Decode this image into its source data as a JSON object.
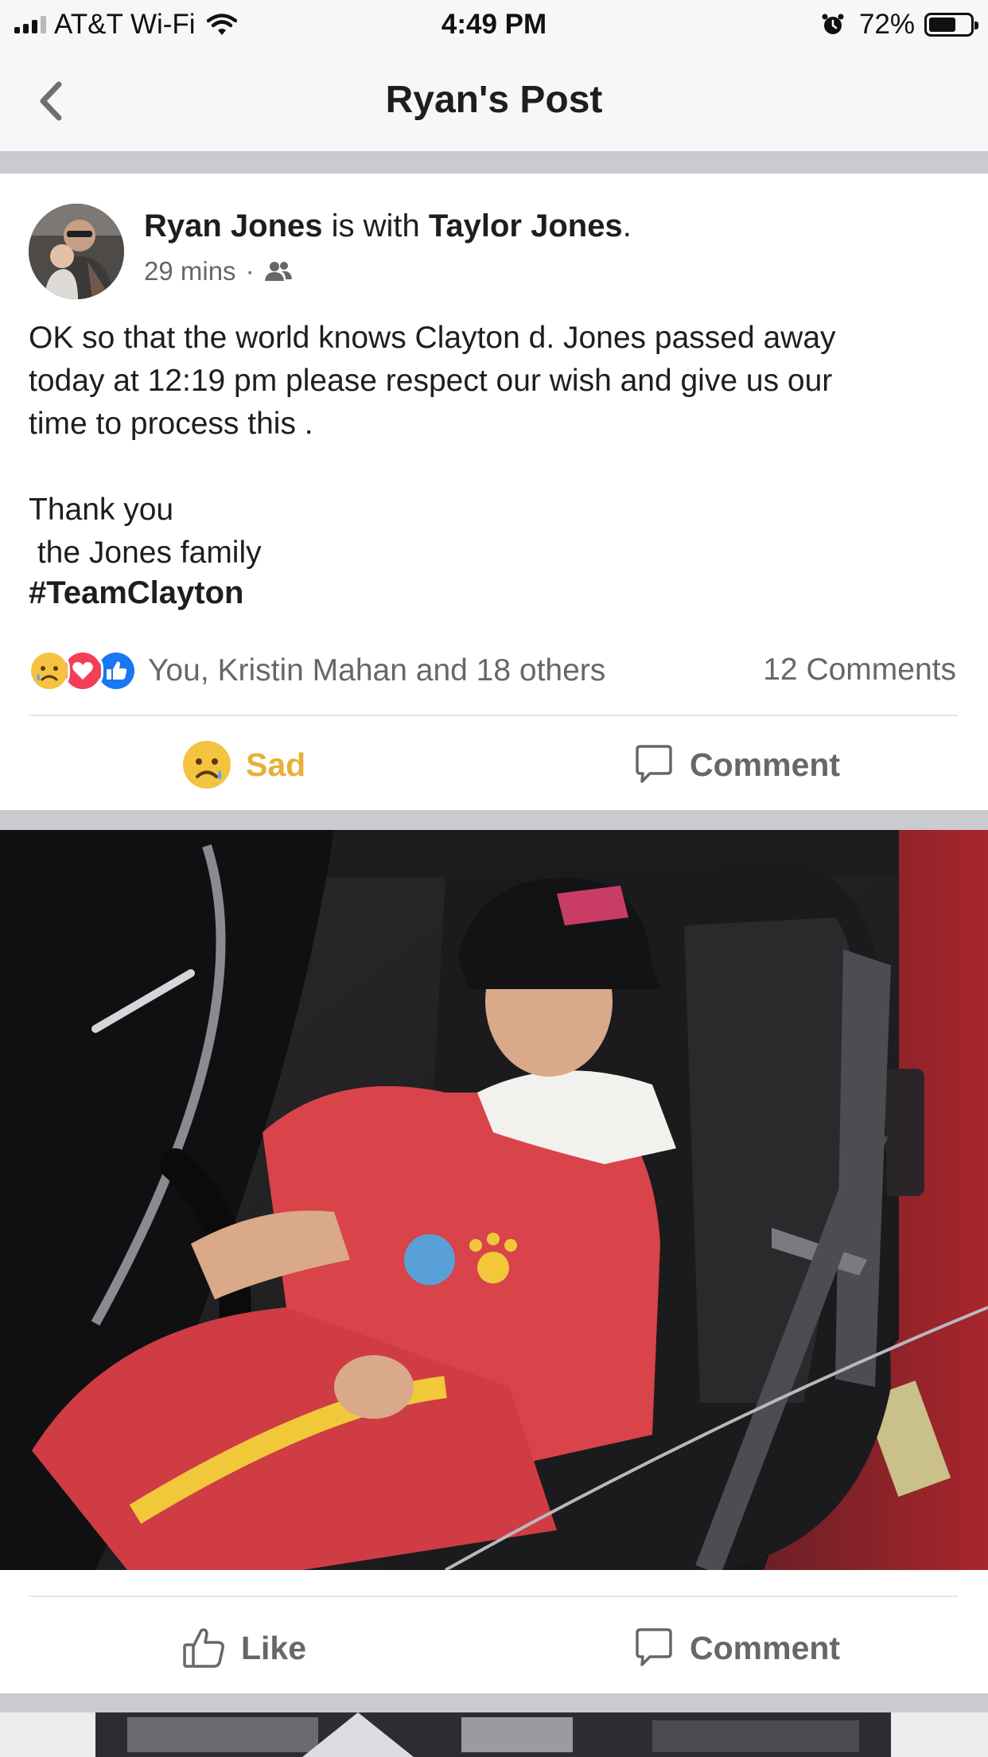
{
  "status_bar": {
    "carrier": "AT&T Wi-Fi",
    "time": "4:49 PM",
    "battery": "72%",
    "battery_level": 0.72
  },
  "nav": {
    "title": "Ryan's Post"
  },
  "post": {
    "author": "Ryan Jones",
    "with_text": " is with ",
    "tagged": "Taylor Jones",
    "tagged_suffix": ".",
    "time": "29 mins",
    "separator": "·",
    "audience_icon": "friends-icon",
    "text_lines": [
      "OK so that the world knows Clayton d. Jones passed away",
      "today at 12:19 pm please  respect our wish and give us our",
      "time to process this .",
      "",
      "Thank you",
      " the Jones family"
    ],
    "hashtag": "#TeamClayton",
    "reaction_icons": [
      "sad-reaction-icon",
      "love-reaction-icon",
      "like-reaction-icon"
    ],
    "reactions_text": "You, Kristin Mahan and 18 others",
    "comments_count": "12 Comments",
    "actions": {
      "sad_label": "Sad",
      "comment_label": "Comment"
    }
  },
  "photo_post": {
    "actions": {
      "like_label": "Like",
      "comment_label": "Comment"
    }
  },
  "colors": {
    "sad": "#e6b03a",
    "love": "#f33e58",
    "like": "#1877f2",
    "secondary_text": "#65676b",
    "separator": "#cacbd0"
  }
}
